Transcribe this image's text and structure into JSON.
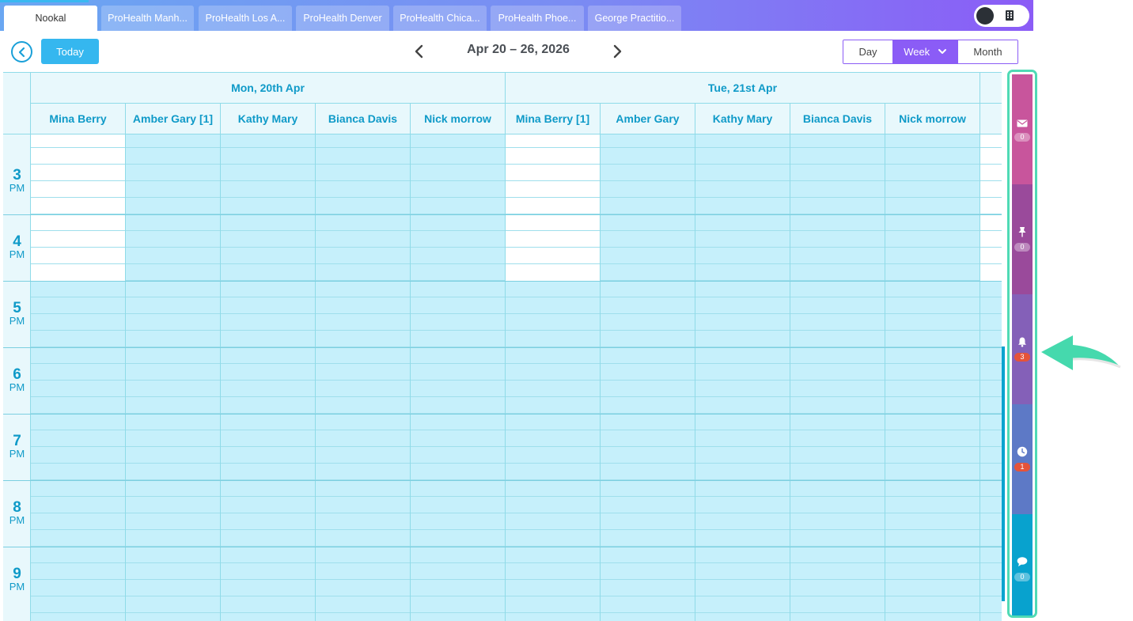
{
  "tabs": [
    {
      "label": "Nookal",
      "active": true
    },
    {
      "label": "ProHealth Manh...",
      "active": false
    },
    {
      "label": "ProHealth Los A...",
      "active": false
    },
    {
      "label": "ProHealth Denver",
      "active": false
    },
    {
      "label": "ProHealth Chica...",
      "active": false
    },
    {
      "label": "ProHealth Phoe...",
      "active": false
    },
    {
      "label": "George Practitio...",
      "active": false
    }
  ],
  "toolbar": {
    "today_label": "Today",
    "date_range": "Apr 20 – 26, 2026",
    "views": [
      {
        "label": "Day",
        "selected": false
      },
      {
        "label": "Week",
        "selected": true
      },
      {
        "label": "Month",
        "selected": false
      }
    ]
  },
  "calendar": {
    "days": [
      {
        "label": "Mon, 20th Apr",
        "practitioners": [
          "Mina Berry",
          "Amber Gary [1]",
          "Kathy Mary",
          "Bianca Davis",
          "Nick morrow"
        ]
      },
      {
        "label": "Tue, 21st Apr",
        "practitioners": [
          "Mina Berry [1]",
          "Amber Gary",
          "Kathy Mary",
          "Bianca Davis",
          "Nick morrow"
        ]
      }
    ],
    "hours": [
      {
        "num": "3",
        "ampm": "PM"
      },
      {
        "num": "4",
        "ampm": "PM"
      },
      {
        "num": "5",
        "ampm": "PM"
      },
      {
        "num": "6",
        "ampm": "PM"
      },
      {
        "num": "7",
        "ampm": "PM"
      },
      {
        "num": "8",
        "ampm": "PM"
      },
      {
        "num": "9",
        "ampm": "PM"
      }
    ]
  },
  "side_panel": {
    "items": [
      {
        "icon": "mail-icon",
        "count": "0",
        "color": "#c8559c",
        "alert": false
      },
      {
        "icon": "pin-icon",
        "count": "0",
        "color": "#9a4a9b",
        "alert": false
      },
      {
        "icon": "bell-icon",
        "count": "3",
        "color": "#8460b8",
        "alert": true
      },
      {
        "icon": "clock-icon",
        "count": "1",
        "color": "#5d79c6",
        "alert": true
      },
      {
        "icon": "chat-icon",
        "count": "0",
        "color": "#08a2ce",
        "alert": false
      }
    ]
  },
  "colors": {
    "accent_purple": "#8b5cf6",
    "accent_blue": "#35b7ef",
    "header_text": "#0f9ac8",
    "highlight_border": "#4fdab5"
  }
}
